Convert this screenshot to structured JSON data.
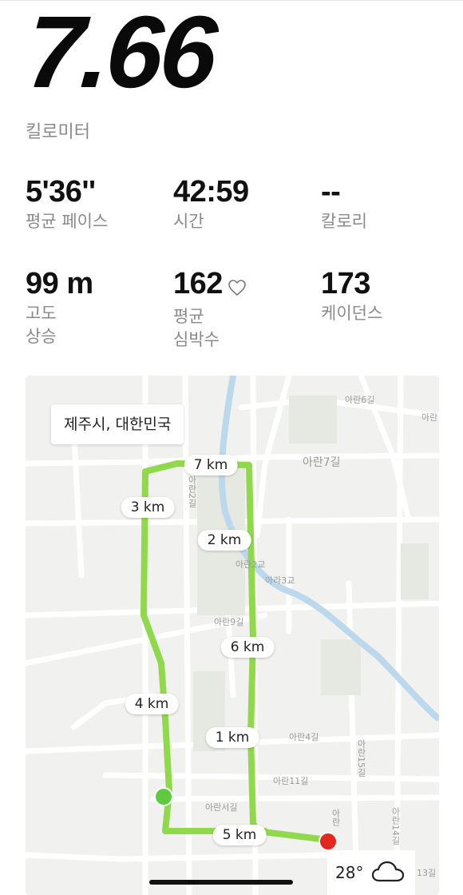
{
  "summary": {
    "distance": "7.66",
    "distance_unit": "킬로미터"
  },
  "stats": [
    {
      "value": "5'36''",
      "label": "평균 페이스"
    },
    {
      "value": "42:59",
      "label": "시간"
    },
    {
      "value": "--",
      "label": "칼로리"
    },
    {
      "value": "99 m",
      "label": "고도\n상승"
    },
    {
      "value": "162",
      "label": "평균\n심박수",
      "icon": "heart-outline-icon"
    },
    {
      "value": "173",
      "label": "케이던스"
    }
  ],
  "map": {
    "location": "제주시, 대한민국",
    "km_markers": [
      "1 km",
      "2 km",
      "3 km",
      "4 km",
      "5 km",
      "6 km",
      "7 km"
    ],
    "road_labels": [
      "아란7길",
      "아란4길",
      "아란11길",
      "아란서길",
      "아란6길",
      "아란",
      "아라3교",
      "아란9길",
      "아란2길",
      "아란15길",
      "아란14길",
      "아란",
      "13길",
      "아란2교"
    ],
    "route_color": "#8fd94a",
    "start_color": "#5ecb3f",
    "end_color": "#e5281f",
    "river_color": "#bcd8ec"
  },
  "weather": {
    "temperature": "28°",
    "icon": "cloud-icon"
  }
}
